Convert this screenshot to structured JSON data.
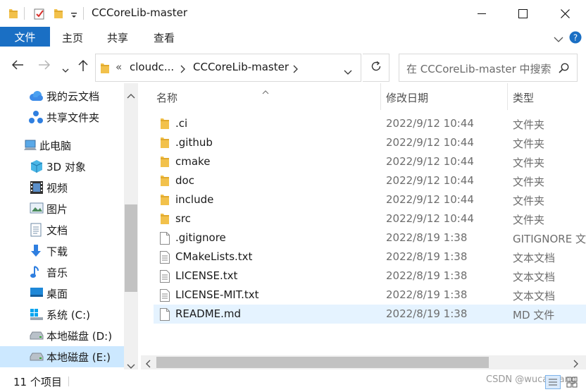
{
  "window": {
    "title": "CCCoreLib-master"
  },
  "ribbon": {
    "tabs": [
      "文件",
      "主页",
      "共享",
      "查看"
    ]
  },
  "address": {
    "overflow": "«",
    "segments": [
      "cloudc...",
      "CCCoreLib-master"
    ]
  },
  "search": {
    "placeholder": "在 CCCoreLib-master 中搜索"
  },
  "nav_pane": {
    "items": [
      {
        "label": "我的云文档",
        "icon": "cloud-docs-icon"
      },
      {
        "label": "共享文件夹",
        "icon": "shared-folder-icon"
      },
      {
        "label": "此电脑",
        "icon": "this-pc-icon"
      },
      {
        "label": "3D 对象",
        "icon": "3d-objects-icon"
      },
      {
        "label": "视频",
        "icon": "video-icon"
      },
      {
        "label": "图片",
        "icon": "pictures-icon"
      },
      {
        "label": "文档",
        "icon": "documents-icon"
      },
      {
        "label": "下载",
        "icon": "downloads-icon"
      },
      {
        "label": "音乐",
        "icon": "music-icon"
      },
      {
        "label": "桌面",
        "icon": "desktop-icon"
      },
      {
        "label": "系统 (C:)",
        "icon": "system-drive-icon"
      },
      {
        "label": "本地磁盘 (D:)",
        "icon": "local-disk-icon"
      },
      {
        "label": "本地磁盘 (E:)",
        "icon": "local-disk-icon"
      }
    ]
  },
  "file_list": {
    "columns": {
      "name": "名称",
      "date": "修改日期",
      "type": "类型"
    },
    "rows": [
      {
        "name": ".ci",
        "date": "2022/9/12 10:44",
        "type": "文件夹",
        "kind": "folder"
      },
      {
        "name": ".github",
        "date": "2022/9/12 10:44",
        "type": "文件夹",
        "kind": "folder"
      },
      {
        "name": "cmake",
        "date": "2022/9/12 10:44",
        "type": "文件夹",
        "kind": "folder"
      },
      {
        "name": "doc",
        "date": "2022/9/12 10:44",
        "type": "文件夹",
        "kind": "folder"
      },
      {
        "name": "include",
        "date": "2022/9/12 10:44",
        "type": "文件夹",
        "kind": "folder"
      },
      {
        "name": "src",
        "date": "2022/9/12 10:44",
        "type": "文件夹",
        "kind": "folder"
      },
      {
        "name": ".gitignore",
        "date": "2022/8/19 1:38",
        "type": "GITIGNORE 文件",
        "kind": "blank"
      },
      {
        "name": "CMakeLists.txt",
        "date": "2022/8/19 1:38",
        "type": "文本文档",
        "kind": "text"
      },
      {
        "name": "LICENSE.txt",
        "date": "2022/8/19 1:38",
        "type": "文本文档",
        "kind": "text"
      },
      {
        "name": "LICENSE-MIT.txt",
        "date": "2022/8/19 1:38",
        "type": "文本文档",
        "kind": "text"
      },
      {
        "name": "README.md",
        "date": "2022/8/19 1:38",
        "type": "MD 文件",
        "kind": "blank"
      }
    ]
  },
  "status": {
    "count": "11 个项目",
    "watermark": "CSDN @wucaiqiang"
  },
  "colors": {
    "accent": "#1a6fc4",
    "folder": "#f2c14b",
    "selection": "#cce8ff"
  }
}
